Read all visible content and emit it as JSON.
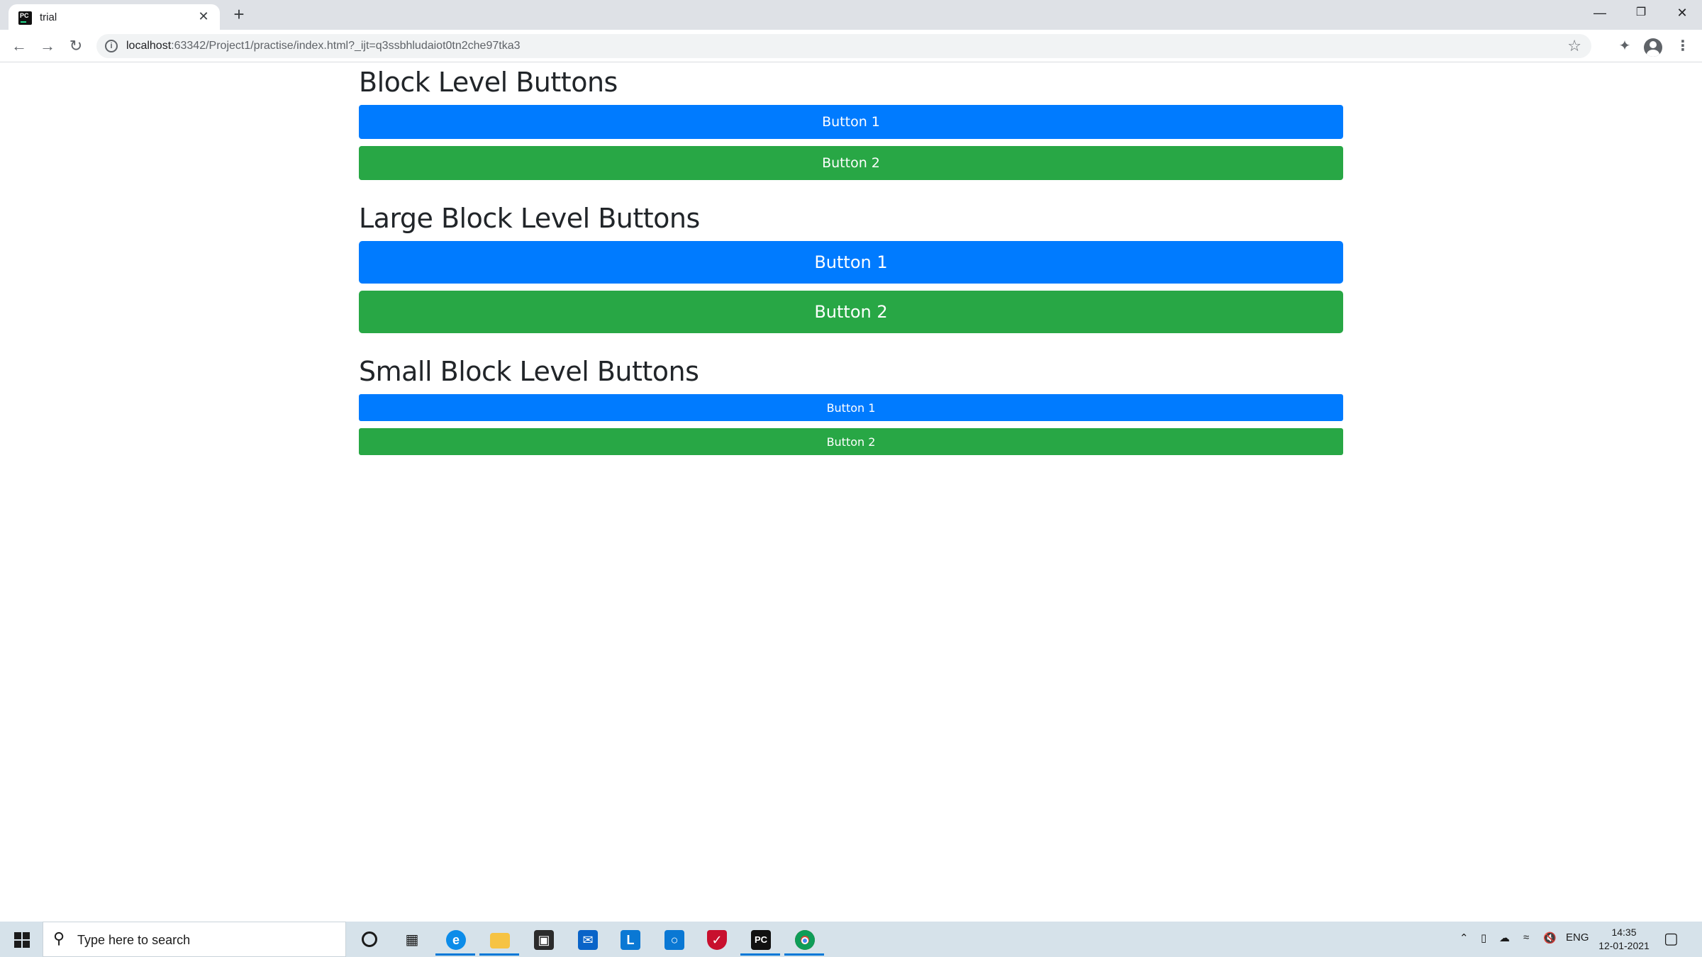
{
  "browser": {
    "tab_title": "trial",
    "tab_close": "✕",
    "new_tab": "+",
    "url_host": "localhost",
    "url_rest": ":63342/Project1/practise/index.html?_ijt=q3ssbhludaiot0tn2che97tka3",
    "window_controls": {
      "minimize": "—",
      "restore": "❐",
      "close": "✕"
    }
  },
  "sections": [
    {
      "heading": "Block Level Buttons",
      "button1": "Button 1",
      "button2": "Button 2"
    },
    {
      "heading": "Large Block Level Buttons",
      "button1": "Button 1",
      "button2": "Button 2"
    },
    {
      "heading": "Small Block Level Buttons",
      "button1": "Button 1",
      "button2": "Button 2"
    }
  ],
  "colors": {
    "primary": "#007bff",
    "success": "#28a745"
  },
  "taskbar": {
    "search_placeholder": "Type here to search",
    "language": "ENG",
    "time": "14:35",
    "date": "12-01-2021",
    "apps": [
      "cortana-icon",
      "task-view-icon",
      "edge-icon",
      "file-explorer-icon",
      "store-icon",
      "mail-icon",
      "l-app-icon",
      "app-icon",
      "mcafee-icon",
      "pycharm-icon",
      "chrome-icon"
    ]
  }
}
